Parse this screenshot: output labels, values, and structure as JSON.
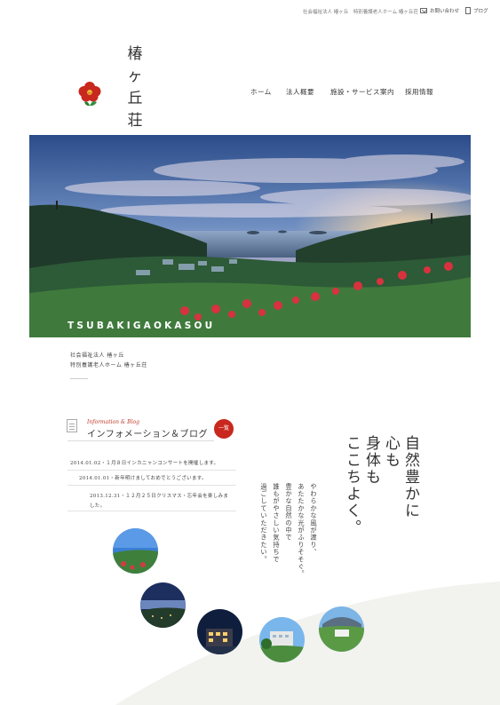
{
  "header": {
    "org_small": "社会福祉法人 椿ヶ丘　特別養護老人ホーム 椿ヶ丘荘",
    "contact_label": "お問い合わせ",
    "blog_label": "ブログ"
  },
  "logo": {
    "chars": [
      "椿",
      "ヶ",
      "丘",
      "荘"
    ]
  },
  "nav": {
    "items": [
      "ホーム",
      "法人概要",
      "施設・サービス案内",
      "採用情報"
    ]
  },
  "hero": {
    "caption": "TSUBAKIGAOKASOU"
  },
  "org": {
    "line1": "社会福祉法人 椿ヶ丘",
    "line2": "特別養護老人ホーム 椿ヶ丘荘"
  },
  "blog": {
    "subtitle": "Information & Blog",
    "title": "インフォメーション＆ブログ",
    "more_label": "一覧",
    "entries": [
      "2014.01.02・１月８日インカニャンコンサートを開催します。",
      "2014.01.01・新年明けましておめでとうございます。",
      "2013.12.31・１２月２５日クリスマス・忘年会を楽しみま",
      "した。"
    ]
  },
  "copy": {
    "headline": [
      "自然豊かに",
      "心も",
      "身体も",
      "ここちよく。"
    ],
    "body": [
      "やわらかな風が渡り、",
      "あたたかな光がふりそそぐ。",
      "豊かな自然の中で",
      "誰もがやさしい気持ちで",
      "過ごしていただきたい。"
    ]
  },
  "colors": {
    "accent": "#c8281e",
    "text": "#333333"
  },
  "icons": {
    "contact": "mail-icon",
    "blog": "document-icon",
    "logo": "camellia-icon"
  }
}
